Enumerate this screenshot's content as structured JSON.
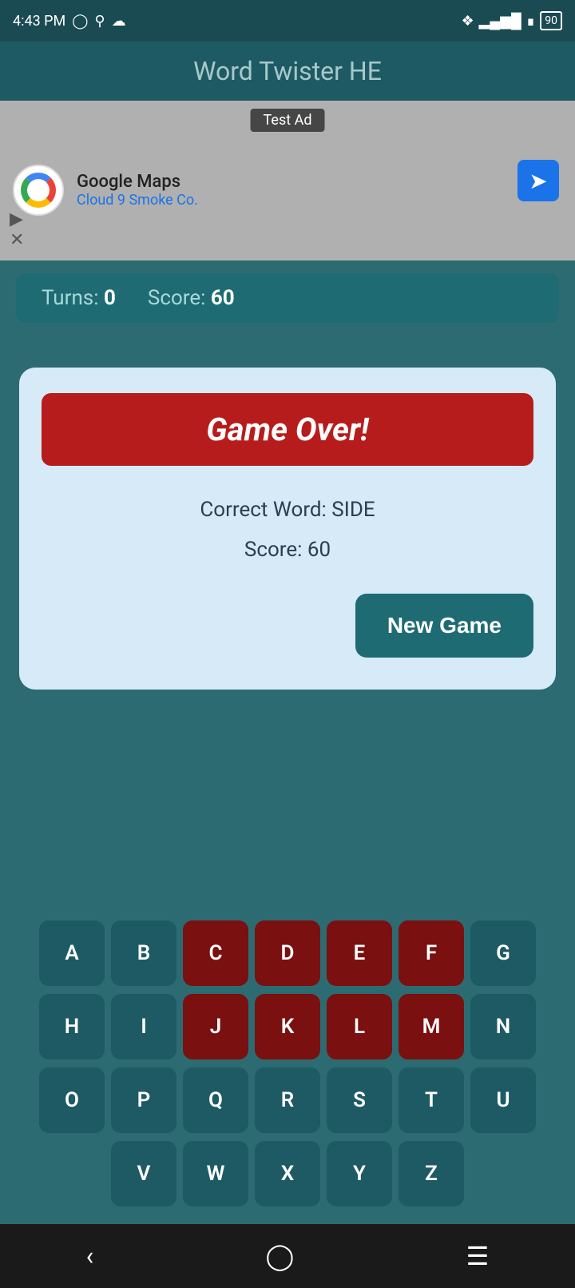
{
  "statusBar": {
    "time": "4:43 PM",
    "battery": "90"
  },
  "appTitle": "Word Twister HE",
  "ad": {
    "label": "Test Ad",
    "companyName": "Google Maps",
    "companySubtitle": "Cloud 9 Smoke Co."
  },
  "scoreBar": {
    "turnsLabel": "Turns:",
    "turnsValue": "0",
    "scoreLabel": "Score:",
    "scoreValue": "60"
  },
  "dialog": {
    "gameOverText": "Game Over!",
    "correctWordLabel": "Correct Word: SIDE",
    "scoreLabel": "Score: 60",
    "newGameLabel": "New Game"
  },
  "keyboard": {
    "rows": [
      [
        {
          "letter": "A",
          "used": false
        },
        {
          "letter": "B",
          "used": false
        },
        {
          "letter": "C",
          "used": true
        },
        {
          "letter": "D",
          "used": true
        },
        {
          "letter": "E",
          "used": true
        },
        {
          "letter": "F",
          "used": true
        },
        {
          "letter": "G",
          "used": false
        }
      ],
      [
        {
          "letter": "H",
          "used": false
        },
        {
          "letter": "I",
          "used": false
        },
        {
          "letter": "J",
          "used": true
        },
        {
          "letter": "K",
          "used": true
        },
        {
          "letter": "L",
          "used": true
        },
        {
          "letter": "M",
          "used": true
        },
        {
          "letter": "N",
          "used": false
        }
      ],
      [
        {
          "letter": "O",
          "used": false
        },
        {
          "letter": "P",
          "used": false
        },
        {
          "letter": "Q",
          "used": false
        },
        {
          "letter": "R",
          "used": false
        },
        {
          "letter": "S",
          "used": false
        },
        {
          "letter": "T",
          "used": false
        },
        {
          "letter": "U",
          "used": false
        }
      ],
      [
        {
          "letter": "V",
          "used": false
        },
        {
          "letter": "W",
          "used": false
        },
        {
          "letter": "X",
          "used": false
        },
        {
          "letter": "Y",
          "used": false
        },
        {
          "letter": "Z",
          "used": false
        }
      ]
    ]
  }
}
